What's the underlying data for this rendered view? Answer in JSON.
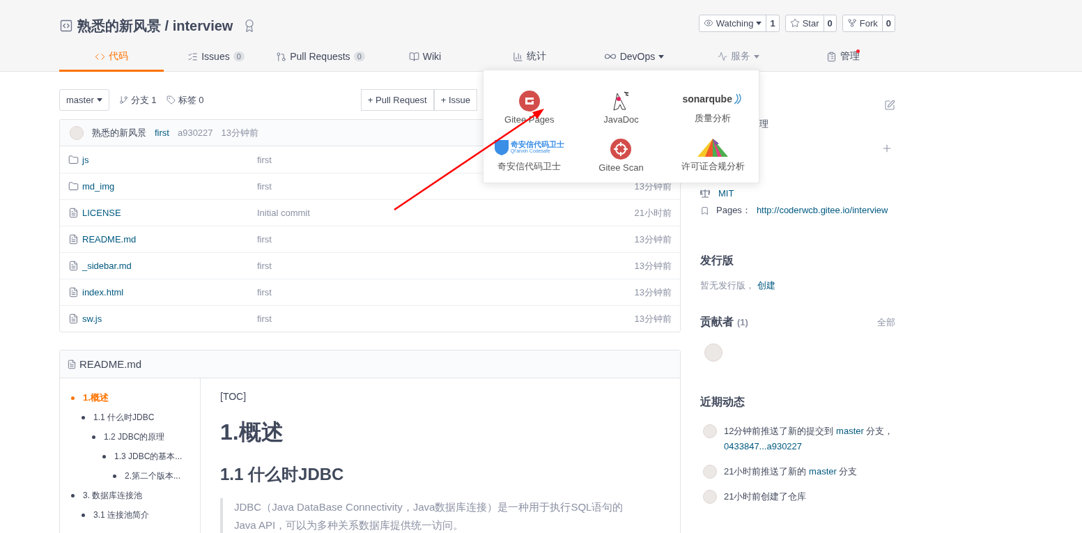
{
  "repo": {
    "owner": "熟悉的新风景",
    "separator": "/",
    "name": "interview"
  },
  "actions": [
    {
      "kind": "watch",
      "label": "Watching",
      "count": "1",
      "caret": true
    },
    {
      "kind": "star",
      "label": "Star",
      "count": "0",
      "caret": false
    },
    {
      "kind": "fork",
      "label": "Fork",
      "count": "0",
      "caret": false
    }
  ],
  "tabs": [
    {
      "kind": "code",
      "label": "代码",
      "selected": true,
      "open": false
    },
    {
      "kind": "issues",
      "label": "Issues",
      "badge": "0",
      "selected": false,
      "open": false
    },
    {
      "kind": "pulls",
      "label": "Pull Requests",
      "badge": "0",
      "selected": false,
      "open": false
    },
    {
      "kind": "wiki",
      "label": "Wiki",
      "selected": false,
      "open": false
    },
    {
      "kind": "stats",
      "label": "统计",
      "selected": false,
      "open": false
    },
    {
      "kind": "devops",
      "label": "DevOps",
      "caret": true,
      "selected": false,
      "open": false
    },
    {
      "kind": "service",
      "label": "服务",
      "caret": true,
      "selected": false,
      "open": true
    },
    {
      "kind": "manage",
      "label": "管理",
      "dot": true,
      "selected": false,
      "open": false
    }
  ],
  "service_menu": [
    {
      "kind": "gitee",
      "label": "Gitee Pages"
    },
    {
      "kind": "javadoc",
      "label": "JavaDoc"
    },
    {
      "kind": "sonar",
      "label": "质量分析",
      "logo_text": "sonarqube"
    },
    {
      "kind": "qianxin",
      "label": "奇安信代码卫士",
      "logo_text": "奇安信代码卫士",
      "logo_subtext": "Qi'anxin Codesafe"
    },
    {
      "kind": "scan",
      "label": "Gitee Scan"
    },
    {
      "kind": "license",
      "label": "许可证合规分析"
    }
  ],
  "toolbar": {
    "branch": "master",
    "branches": "分支 1",
    "tags": "标签 0",
    "buttons": [
      "+ Pull Request",
      "+ Issue"
    ]
  },
  "commit": {
    "author": "熟悉的新风景",
    "message": "first",
    "hash": "a930227",
    "time": "13分钟前"
  },
  "files": [
    {
      "kind": "folder",
      "name": "js",
      "message": "first"
    },
    {
      "kind": "folder",
      "name": "md_img",
      "message": "first",
      "time": "13分钟前"
    },
    {
      "kind": "file",
      "name": "LICENSE",
      "message": "Initial commit",
      "time": "21小时前"
    },
    {
      "kind": "file",
      "name": "README.md",
      "message": "first",
      "time": "13分钟前"
    },
    {
      "kind": "file",
      "name": "_sidebar.md",
      "message": "first",
      "time": "13分钟前"
    },
    {
      "kind": "file",
      "name": "index.html",
      "message": "first",
      "time": "13分钟前"
    },
    {
      "kind": "file",
      "name": "sw.js",
      "message": "first",
      "time": "13分钟前"
    }
  ],
  "readme": {
    "title": "README.md",
    "toc": [
      {
        "label": "1.概述",
        "selected": true,
        "children": [
          {
            "label": "1.1 什么时JDBC",
            "selected": false,
            "children": [
              {
                "label": "1.2 JDBC的原理",
                "selected": false,
                "children": [
                  {
                    "label": "1.3 JDBC的基本...",
                    "selected": false,
                    "children": [
                      {
                        "label": "2.第二个版本...",
                        "selected": false
                      }
                    ]
                  }
                ]
              }
            ]
          }
        ]
      },
      {
        "label": "3. 数据库连接池",
        "selected": false,
        "children": [
          {
            "label": "3.1 连接池简介",
            "selected": false
          }
        ]
      }
    ],
    "content": {
      "toc_marker": "[TOC]",
      "h1": "1.概述",
      "h2": "1.1 什么时JDBC",
      "quote": "JDBC（Java DataBase Connectivity，Java数据库连接）是一种用于执行SQL语句的Java API，可以为多种关系数据库提供统一访问。"
    }
  },
  "sidebar": {
    "intro_fragment": "理",
    "license": "MIT",
    "pages_label": "Pages：",
    "pages_url": "http://coderwcb.gitee.io/interview",
    "releases": {
      "title": "发行版",
      "empty": "暂无发行版，",
      "create": "创建"
    },
    "contributors": {
      "title": "贡献者",
      "count": "(1)",
      "all": "全部"
    },
    "activity": {
      "title": "近期动态",
      "items": [
        [
          {
            "text": "12分钟前推送了新的提交到 ",
            "link": false
          },
          {
            "text": "master",
            "link": true
          },
          {
            "text": " 分支，",
            "link": false
          },
          {
            "text": "0433847...a930227",
            "link": true
          }
        ],
        [
          {
            "text": "21小时前推送了新的 ",
            "link": false
          },
          {
            "text": "master",
            "link": true
          },
          {
            "text": " 分支",
            "link": false
          }
        ],
        [
          {
            "text": "21小时前创建了仓库",
            "link": false
          }
        ]
      ]
    }
  }
}
